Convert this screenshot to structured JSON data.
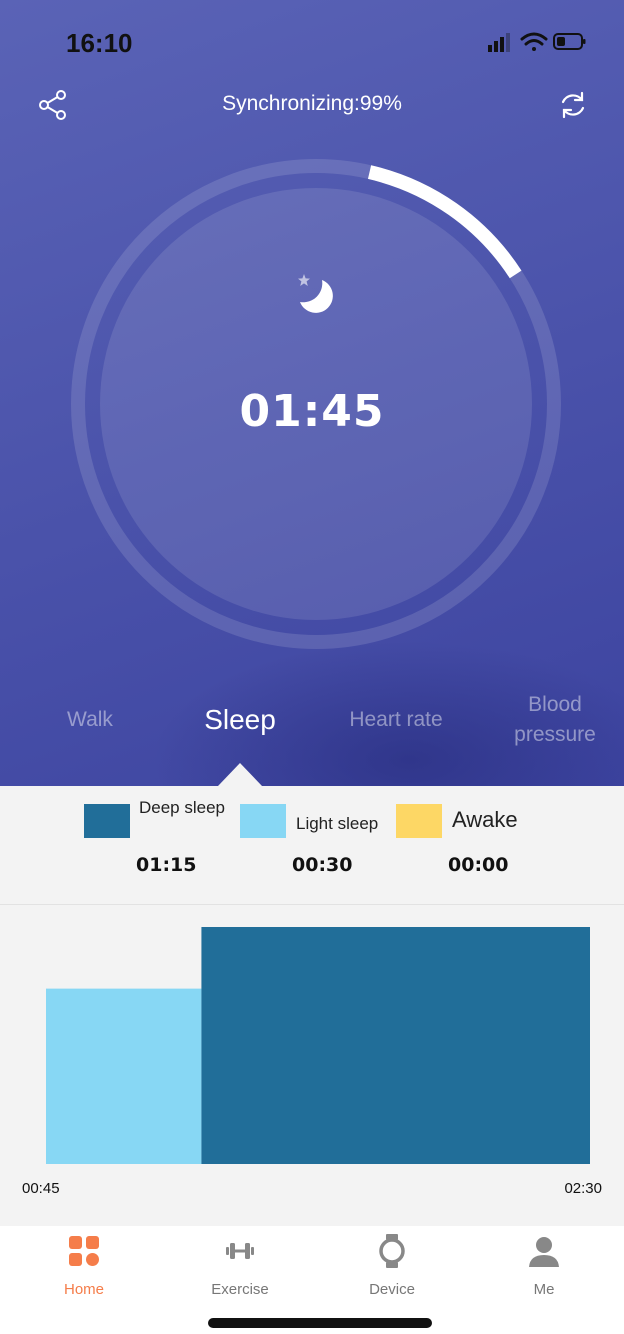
{
  "status_bar": {
    "time": "16:10"
  },
  "header": {
    "title": "Synchronizing:99%",
    "share_icon": "share-icon",
    "sync_icon": "sync-icon"
  },
  "sleep_ring": {
    "time": "01:45",
    "progress_fraction": 0.1,
    "icon": "moon-star-icon"
  },
  "tabs": [
    {
      "label": "Walk"
    },
    {
      "label": "Sleep",
      "active": true
    },
    {
      "label": "Heart rate"
    },
    {
      "label": "Blood pressure"
    }
  ],
  "legend": [
    {
      "label": "Deep sleep",
      "value": "01:15",
      "color": "#216e99"
    },
    {
      "label": "Light sleep",
      "value": "00:30",
      "color": "#87d7f4"
    },
    {
      "label": "Awake",
      "value": "00:00",
      "color": "#fdd765"
    }
  ],
  "chart_data": {
    "type": "bar",
    "x_start_label": "00:45",
    "x_end_label": "02:30",
    "segments": [
      {
        "stage": "Light sleep",
        "duration_min": 30,
        "level": 0.74,
        "color": "#87d7f4"
      },
      {
        "stage": "Deep sleep",
        "duration_min": 75,
        "level": 1.0,
        "color": "#216e99"
      }
    ]
  },
  "nav": [
    {
      "label": "Home",
      "icon": "home-grid-icon",
      "active": true
    },
    {
      "label": "Exercise",
      "icon": "dumbbell-icon"
    },
    {
      "label": "Device",
      "icon": "watch-icon"
    },
    {
      "label": "Me",
      "icon": "user-icon"
    }
  ]
}
